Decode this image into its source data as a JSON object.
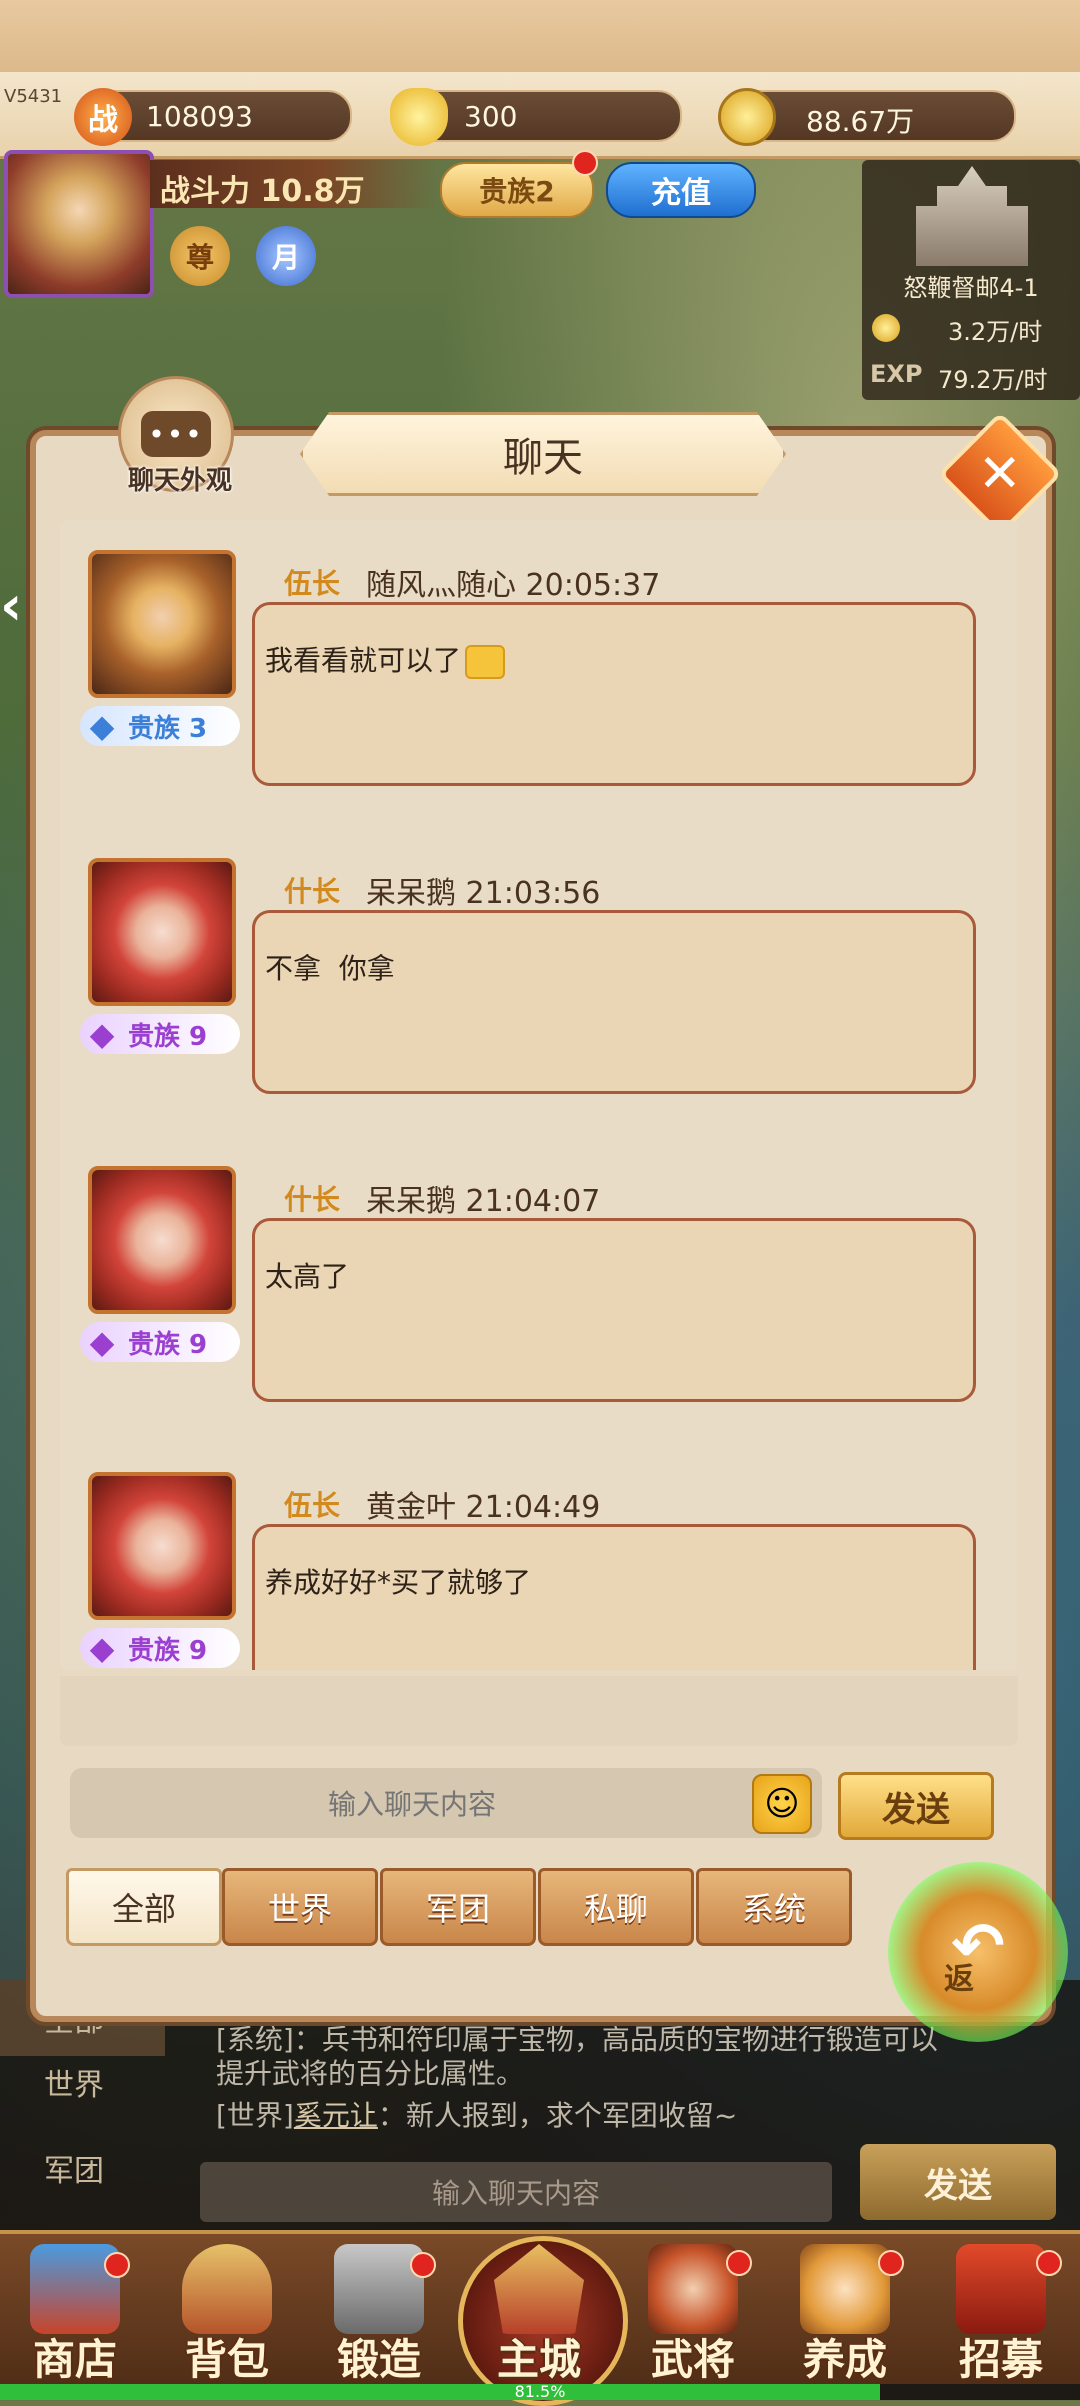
{
  "top_bar": {
    "version": "V5431",
    "combat_icon_label": "战",
    "combat_value": "108093",
    "gold_value": "300",
    "coin_value": "88.67万"
  },
  "player": {
    "power_label": "战斗力 10.8万",
    "noble_button": "贵族2",
    "recharge_button": "充值",
    "honor_button": "尊",
    "month_button": "月"
  },
  "stage": {
    "name": "怒鞭督邮4-1",
    "coin_rate": "3.2万/时",
    "exp_label": "EXP",
    "exp_rate": "79.2万/时"
  },
  "chat_modal": {
    "title": "聊天",
    "appearance_label": "聊天外观",
    "appearance_icon_text": "•••",
    "close_glyph": "✕",
    "messages": [
      {
        "rank": "伍长",
        "sender": "随风灬随心",
        "time": "20:05:37",
        "text": "我看看就可以了",
        "has_emoji": true,
        "noble": "贵族 3",
        "noble_color": "#3b7fd8",
        "portrait": "gold"
      },
      {
        "rank": "什长",
        "sender": "呆呆鹅",
        "time": "21:03:56",
        "text": "不拿  你拿",
        "has_emoji": false,
        "noble": "贵族 9",
        "noble_color": "#9a3fcf",
        "portrait": "red"
      },
      {
        "rank": "什长",
        "sender": "呆呆鹅",
        "time": "21:04:07",
        "text": "太高了",
        "has_emoji": false,
        "noble": "贵族 9",
        "noble_color": "#9a3fcf",
        "portrait": "red"
      },
      {
        "rank": "伍长",
        "sender": "黄金叶",
        "time": "21:04:49",
        "text": "养成好好*买了就够了",
        "has_emoji": false,
        "noble": "贵族 9",
        "noble_color": "#9a3fcf",
        "portrait": "red"
      }
    ],
    "input_placeholder": "输入聊天内容",
    "send_button": "发送",
    "tabs": [
      "全部",
      "世界",
      "军团",
      "私聊",
      "系统"
    ],
    "active_tab": "全部"
  },
  "return_button": {
    "label": "返"
  },
  "background_chat": {
    "side_tabs": [
      "全部",
      "世界",
      "军团"
    ],
    "line1": "[系统]：兵书和符印属于宝物，高品质的宝物进行锻造可以",
    "line2": "提升武将的百分比属性。",
    "line3_prefix": "[世界]",
    "line3_name": "奚元让",
    "line3_text": "：新人报到，求个军团收留~",
    "input_placeholder": "输入聊天内容",
    "send_button": "发送"
  },
  "bottom_nav": {
    "items": [
      "商店",
      "背包",
      "锻造",
      "主城",
      "武将",
      "养成",
      "招募"
    ],
    "active": "主城"
  },
  "loading": {
    "percent_text": "81.5%",
    "fraction": 0.815
  },
  "colors": {
    "modal_bg": "#e8d9c2",
    "bubble_bg": "#ead5b4",
    "bubble_border": "#a85a3a",
    "rank_color": "#d28a1e",
    "accent_blue": "#1f6fd0",
    "progress_green": "#2fbf3a"
  },
  "icons": {
    "combat": "combat-icon",
    "gold_ingot": "gold-ingot-icon",
    "coin": "coin-icon",
    "close": "close-icon",
    "smiley": "smiley-icon",
    "diamond": "diamond-gem-icon",
    "return": "return-arrow-icon"
  }
}
